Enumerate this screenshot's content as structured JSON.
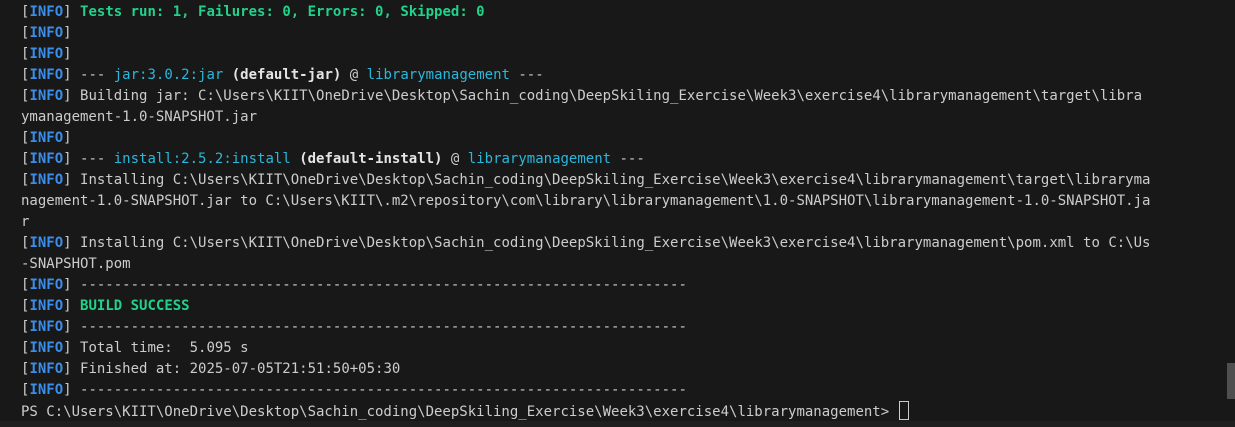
{
  "colors": {
    "background": "#181818",
    "text": "#cccccc",
    "info_tag": "#3b8eea",
    "success_green": "#23d18b",
    "plugin_cyan": "#29b8db",
    "bold_white": "#e5e5e5"
  },
  "terminal": {
    "info_tag": "INFO",
    "line1": {
      "rest": "Tests run: 1, Failures: 0, Errors: 0, Skipped: 0"
    },
    "line4": {
      "prefix": " --- ",
      "plugin": "jar:3.0.2:jar",
      "exec": " (default-jar)",
      "at": " @ ",
      "project": "librarymanagement",
      "suffix": " ---"
    },
    "line5": {
      "rest": " Building jar: C:\\Users\\KIIT\\OneDrive\\Desktop\\Sachin_coding\\DeepSkiling_Exercise\\Week3\\exercise4\\librarymanagement\\target\\libra"
    },
    "line6": {
      "text": "ymanagement-1.0-SNAPSHOT.jar"
    },
    "line8": {
      "prefix": " --- ",
      "plugin": "install:2.5.2:install",
      "exec": " (default-install)",
      "at": " @ ",
      "project": "librarymanagement",
      "suffix": " ---"
    },
    "line9": {
      "rest": " Installing C:\\Users\\KIIT\\OneDrive\\Desktop\\Sachin_coding\\DeepSkiling_Exercise\\Week3\\exercise4\\librarymanagement\\target\\libraryma"
    },
    "line10": {
      "text": "nagement-1.0-SNAPSHOT.jar to C:\\Users\\KIIT\\.m2\\repository\\com\\library\\librarymanagement\\1.0-SNAPSHOT\\librarymanagement-1.0-SNAPSHOT.ja"
    },
    "line11": {
      "text": "r"
    },
    "line12": {
      "rest": " Installing C:\\Users\\KIIT\\OneDrive\\Desktop\\Sachin_coding\\DeepSkiling_Exercise\\Week3\\exercise4\\librarymanagement\\pom.xml to C:\\Us"
    },
    "line13": {
      "text": "-SNAPSHOT.pom"
    },
    "separator": " ------------------------------------------------------------------------",
    "build_success": "BUILD SUCCESS",
    "total_time": " Total time:  5.095 s",
    "finished_at": " Finished at: 2025-07-05T21:51:50+05:30",
    "prompt": "PS C:\\Users\\KIIT\\OneDrive\\Desktop\\Sachin_coding\\DeepSkiling_Exercise\\Week3\\exercise4\\librarymanagement> "
  }
}
